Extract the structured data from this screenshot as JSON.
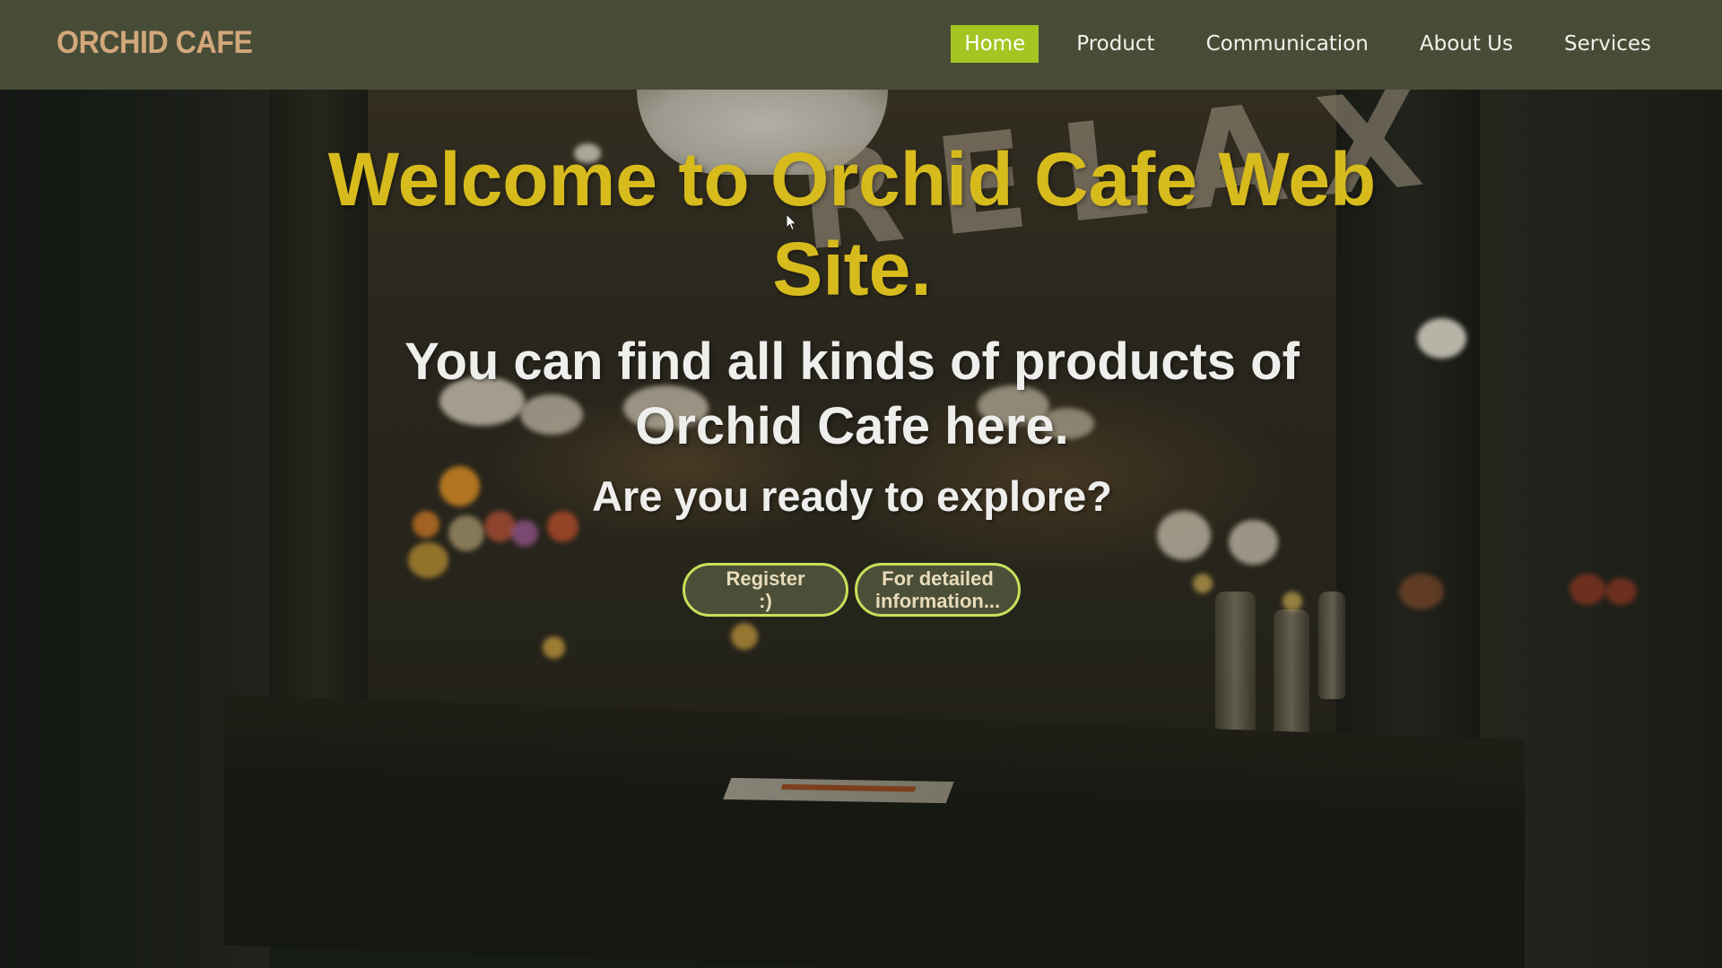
{
  "header": {
    "logo_text": "ORCHID CAFE",
    "nav_items": [
      {
        "label": "Home",
        "active": true
      },
      {
        "label": "Product",
        "active": false
      },
      {
        "label": "Communication",
        "active": false
      },
      {
        "label": "About Us",
        "active": false
      },
      {
        "label": "Services",
        "active": false
      }
    ]
  },
  "hero": {
    "background_sign_text": "RELAX",
    "welcome_heading": "Welcome to Orchid Cafe Web Site.",
    "subtitle": "You can find all kinds of products of Orchid Cafe here.",
    "question": "Are you ready to explore?",
    "buttons": {
      "register_label": "Register\n:)",
      "info_label": "For detailed\ninformation..."
    }
  },
  "colors": {
    "header_background": "#474c37",
    "logo": "#d2a77a",
    "nav_active_background": "#a5c522",
    "welcome_text": "#d7bb1d",
    "body_text": "#eeeeec",
    "button_border": "#c7e05a",
    "button_background": "#4b4f38"
  },
  "icons": {
    "cursor": "mouse-pointer-icon"
  }
}
